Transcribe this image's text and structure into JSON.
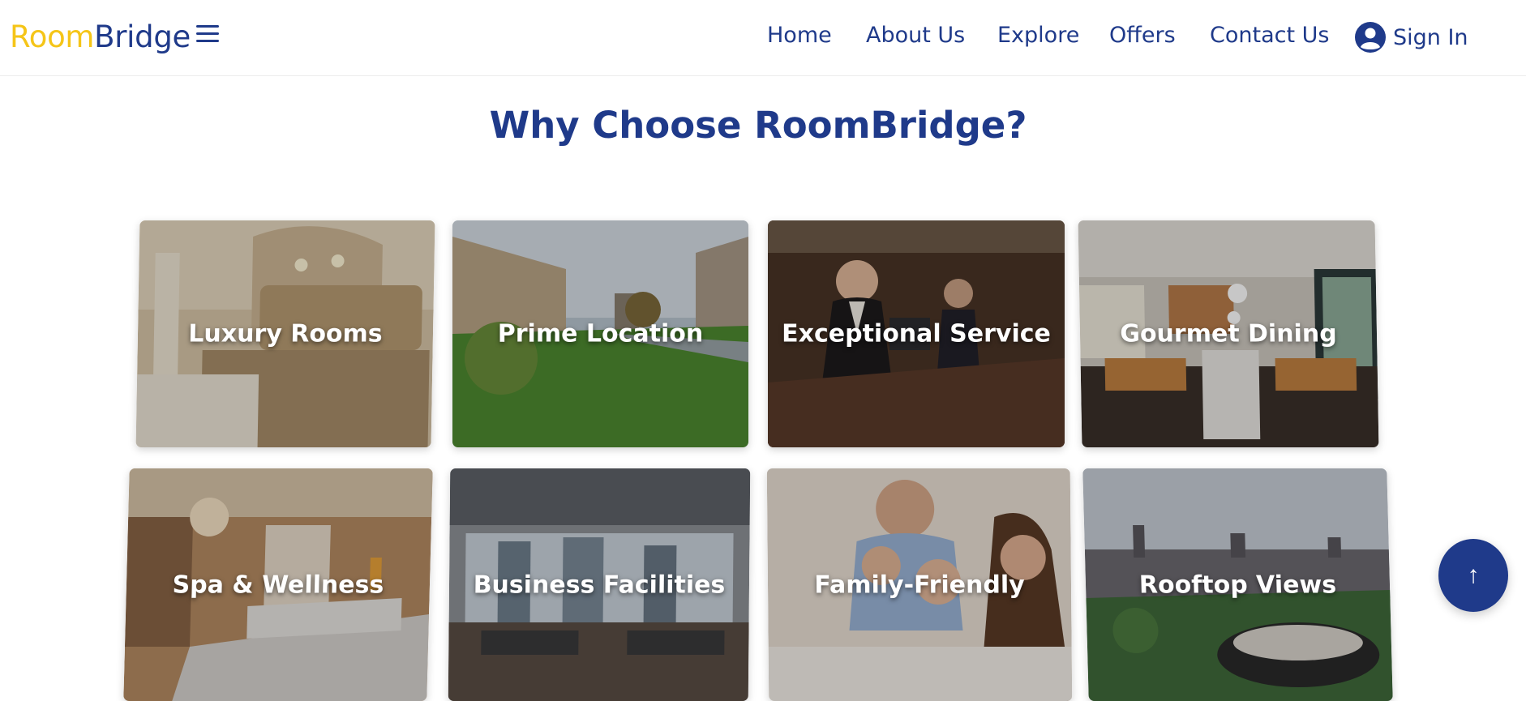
{
  "brand": {
    "part1": "Room",
    "part2": "Bridge"
  },
  "nav": {
    "links": [
      "Home",
      "About Us",
      "Explore",
      "Offers",
      "Contact Us"
    ],
    "signin_label": "Sign In"
  },
  "section": {
    "title": "Why Choose RoomBridge?"
  },
  "features": [
    {
      "label": "Luxury Rooms"
    },
    {
      "label": "Prime Location"
    },
    {
      "label": "Exceptional Service"
    },
    {
      "label": "Gourmet Dining"
    },
    {
      "label": "Spa & Wellness"
    },
    {
      "label": "Business Facilities"
    },
    {
      "label": "Family-Friendly"
    },
    {
      "label": "Rooftop Views"
    }
  ],
  "scroll_top": {
    "glyph": "↑"
  },
  "colors": {
    "brand_yellow": "#f5c518",
    "brand_blue": "#1f3a8a"
  }
}
